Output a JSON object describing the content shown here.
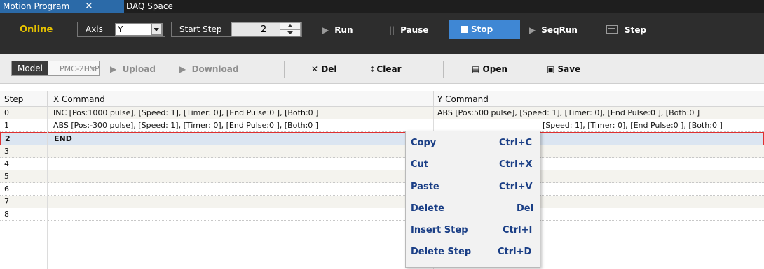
{
  "tabs": [
    {
      "label": "Motion Program",
      "active": true,
      "closable": true
    },
    {
      "label": "DAQ Space",
      "active": false
    }
  ],
  "toolbar": {
    "status": "Online",
    "axis_label": "Axis",
    "axis_value": "Y",
    "start_step_label": "Start Step",
    "start_step_value": "2",
    "run": "Run",
    "pause": "Pause",
    "stop": "Stop",
    "seqrun": "SeqRun",
    "step": "Step"
  },
  "toolbar2": {
    "model_label": "Model",
    "model_value": "PMC-2HSP",
    "upload": "Upload",
    "download": "Download",
    "del": "Del",
    "clear": "Clear",
    "open": "Open",
    "save": "Save"
  },
  "grid": {
    "columns": [
      "Step",
      "X Command",
      "Y Command"
    ],
    "rows": [
      {
        "step": "0",
        "x": "INC [Pos:1000 pulse], [Speed: 1], [Timer: 0], [End Pulse:0 ], [Both:0 ]",
        "y": "ABS [Pos:500 pulse], [Speed: 1], [Timer: 0], [End Pulse:0 ], [Both:0 ]"
      },
      {
        "step": "1",
        "x": "ABS [Pos:-300 pulse], [Speed: 1], [Timer: 0], [End Pulse:0 ], [Both:0 ]",
        "y": "[Speed: 1], [Timer: 0], [End Pulse:0 ], [Both:0 ]"
      },
      {
        "step": "2",
        "x": "END",
        "y": ""
      },
      {
        "step": "3",
        "x": "",
        "y": ""
      },
      {
        "step": "4",
        "x": "",
        "y": ""
      },
      {
        "step": "5",
        "x": "",
        "y": ""
      },
      {
        "step": "6",
        "x": "",
        "y": ""
      },
      {
        "step": "7",
        "x": "",
        "y": ""
      },
      {
        "step": "8",
        "x": "",
        "y": ""
      }
    ],
    "selected_step": "2"
  },
  "context_menu": [
    {
      "label": "Copy",
      "shortcut": "Ctrl+C"
    },
    {
      "label": "Cut",
      "shortcut": "Ctrl+X"
    },
    {
      "label": "Paste",
      "shortcut": "Ctrl+V"
    },
    {
      "label": "Delete",
      "shortcut": "Del"
    },
    {
      "label": "Insert Step",
      "shortcut": "Ctrl+I"
    },
    {
      "label": "Delete Step",
      "shortcut": "Ctrl+D"
    }
  ],
  "colors": {
    "tab_active": "#2b6aa8",
    "toolbar_dark": "#2d2d2d",
    "online": "#e6c200",
    "stop_active": "#3f87d4",
    "selected_row": "#dbe5f1",
    "selected_border": "#e03030",
    "menu_text": "#1b3f86"
  },
  "icons": [
    "close-icon",
    "dropdown-arrow-icon",
    "spinner-up-icon",
    "spinner-down-icon",
    "play-icon",
    "pause-icon",
    "stop-icon",
    "seqrun-icon",
    "step-icon",
    "upload-icon",
    "download-icon",
    "delete-x-icon",
    "clear-icon",
    "open-folder-icon",
    "save-disk-icon"
  ]
}
